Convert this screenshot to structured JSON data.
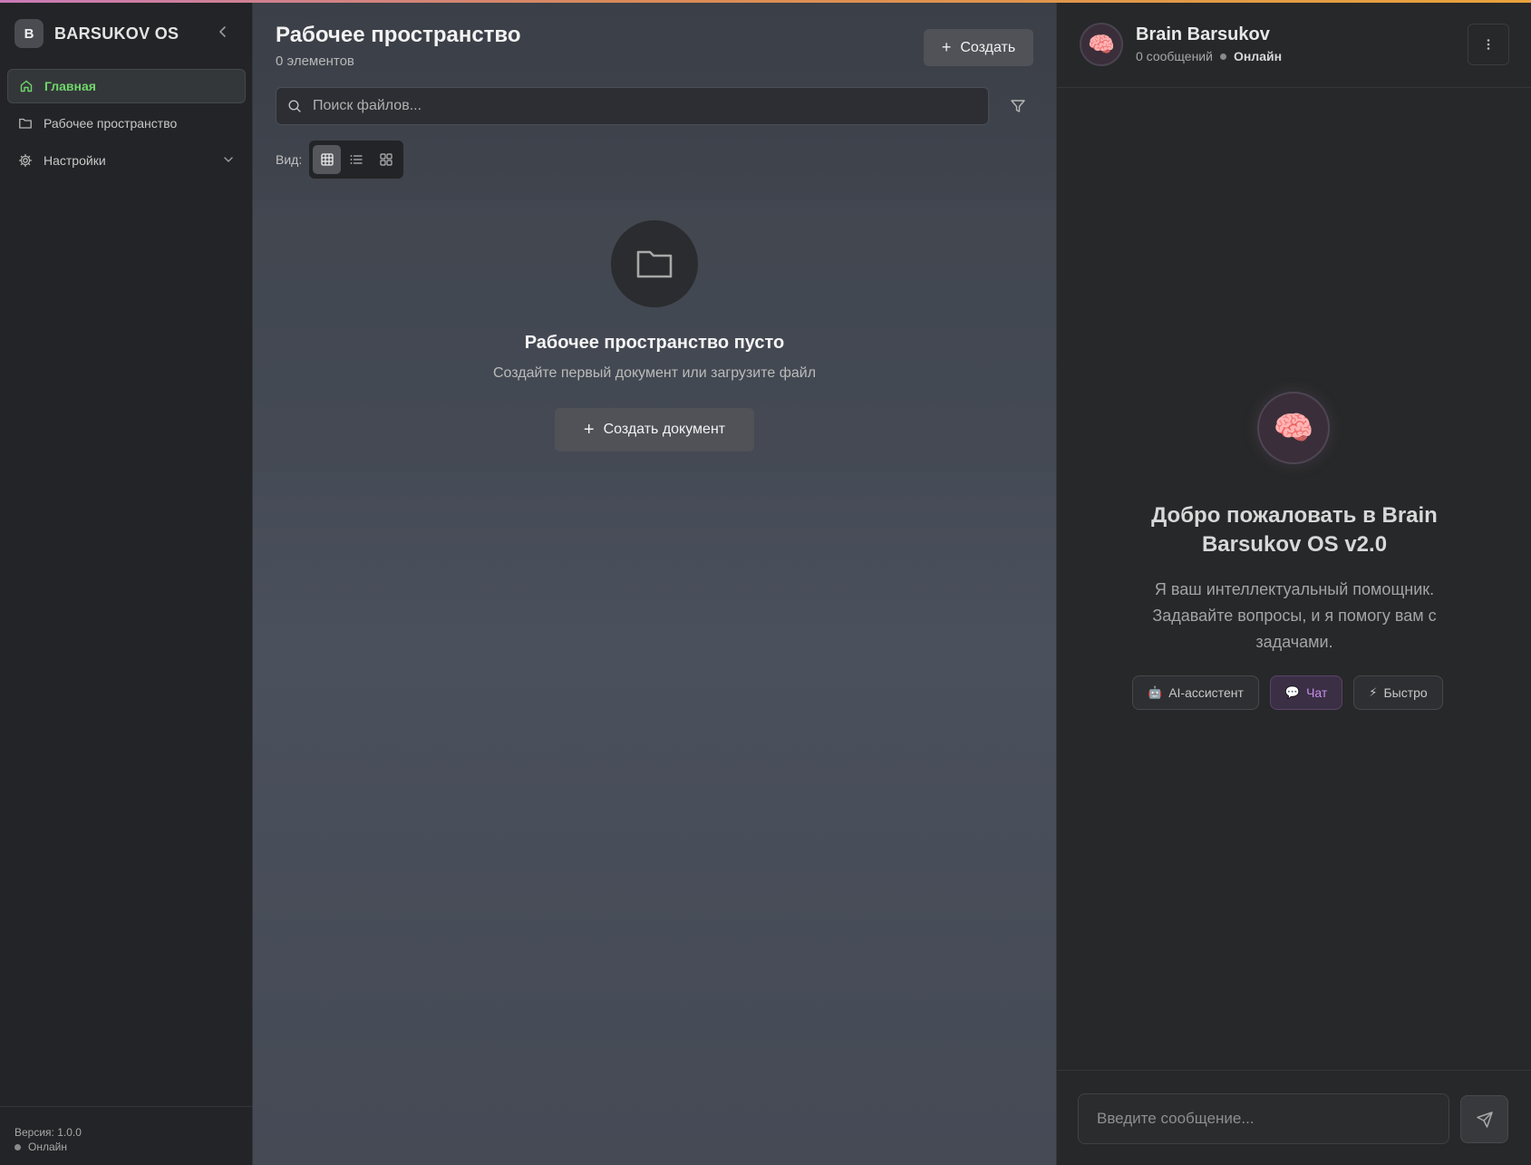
{
  "sidebar": {
    "brand_letter": "B",
    "brand_name": "BARSUKOV OS",
    "items": [
      {
        "label": "Главная",
        "icon": "home-icon",
        "active": true
      },
      {
        "label": "Рабочее пространство",
        "icon": "folder-icon",
        "active": false
      },
      {
        "label": "Настройки",
        "icon": "gear-icon",
        "active": false,
        "expandable": true
      }
    ],
    "footer": {
      "version": "Версия: 1.0.0",
      "status": "Онлайн"
    }
  },
  "workspace": {
    "title": "Рабочее пространство",
    "count": "0 элементов",
    "create_label": "Создать",
    "search_placeholder": "Поиск файлов...",
    "view_label": "Вид:",
    "view_modes": [
      "table",
      "list",
      "grid"
    ],
    "active_view": "table",
    "empty": {
      "title": "Рабочее пространство пусто",
      "subtitle": "Создайте первый документ или загрузите файл",
      "button": "Создать документ"
    }
  },
  "chat": {
    "name": "Brain Barsukov",
    "messages_count": "0 сообщений",
    "status": "Онлайн",
    "avatar_emoji": "🧠",
    "welcome_title": "Добро пожаловать в Brain Barsukov OS v2.0",
    "welcome_text": "Я ваш интеллектуальный помощник. Задавайте вопросы, и я помогу вам с задачами.",
    "chips": [
      {
        "emoji": "🤖",
        "label": "AI-ассистент",
        "active": false
      },
      {
        "emoji": "💬",
        "label": "Чат",
        "active": true
      },
      {
        "emoji": "⚡",
        "label": "Быстро",
        "active": false
      }
    ],
    "input_placeholder": "Введите сообщение..."
  },
  "colors": {
    "accent_green": "#6fd66a",
    "accent_purple": "#c48ee6",
    "top_gradient_start": "#c97ab8",
    "top_gradient_end": "#e8a23c"
  }
}
